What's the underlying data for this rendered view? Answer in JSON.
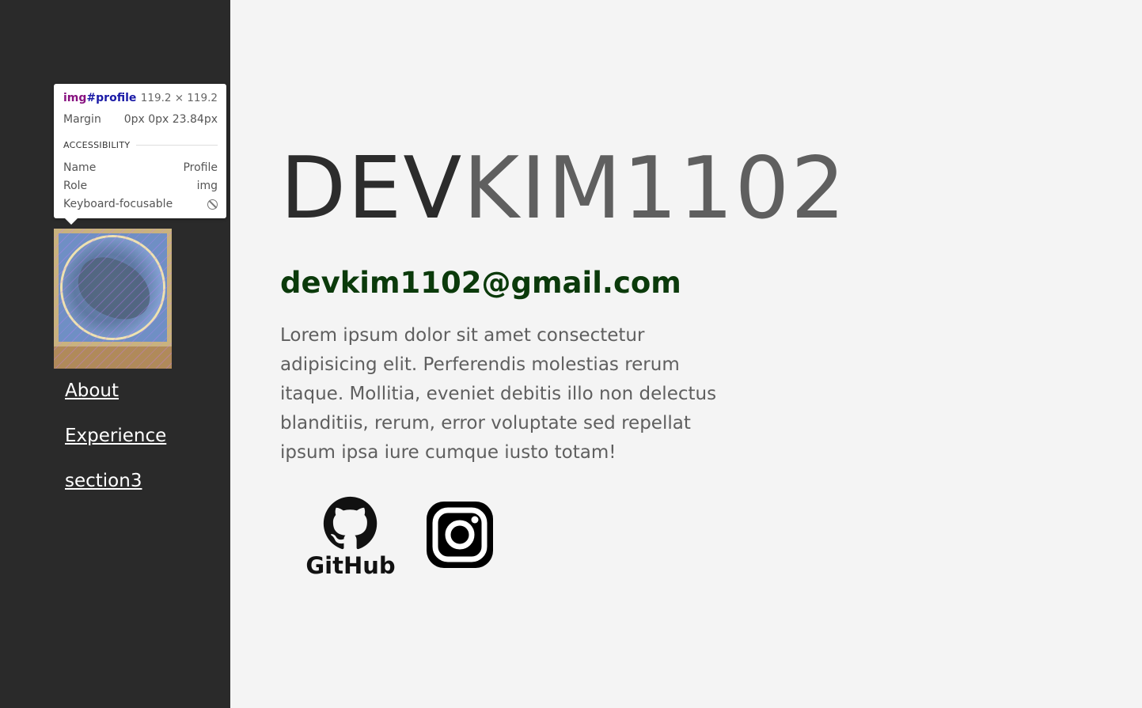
{
  "inspector": {
    "tag": "img",
    "id": "#profile",
    "dimensions": "119.2 × 119.2",
    "margin_label": "Margin",
    "margin_value": "0px 0px 23.84px",
    "section": "ACCESSIBILITY",
    "name_label": "Name",
    "name_value": "Profile",
    "role_label": "Role",
    "role_value": "img",
    "focusable_label": "Keyboard-focusable"
  },
  "nav": {
    "items": [
      {
        "label": "About"
      },
      {
        "label": "Experience"
      },
      {
        "label": "section3"
      }
    ]
  },
  "hero": {
    "title_dark": "DEV",
    "title_light": "KIM1102",
    "email": "devkim1102@gmail.com",
    "description": "Lorem ipsum dolor sit amet consectetur adipisicing elit. Perferendis molestias rerum itaque. Mollitia, eveniet debitis illo non delectus blanditiis, rerum, error voluptate sed repellat ipsum ipsa iure cumque iusto totam!"
  },
  "social": {
    "github_text": "GitHub",
    "github_icon": "github-icon",
    "instagram_icon": "instagram-icon"
  },
  "colors": {
    "sidebar_bg": "#2a2a2a",
    "page_bg": "#f4f4f4",
    "email": "#0b3a0b",
    "title_dark": "#2c2c2c",
    "title_light": "#5f5f5f"
  }
}
